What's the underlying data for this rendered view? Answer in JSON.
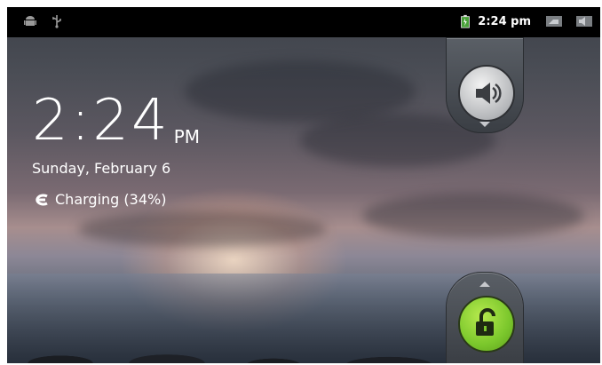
{
  "status_bar": {
    "left_icons": [
      "android-notification-icon",
      "usb-icon"
    ],
    "time": "2:24 pm",
    "right_icons": [
      "battery-charging-icon",
      "signal-icon",
      "volume-icon"
    ]
  },
  "lockscreen": {
    "time": "2:24",
    "ampm": "PM",
    "date": "Sunday, February 6",
    "charging_text": "Charging (34%)"
  },
  "controls": {
    "sound_toggle_icon": "speaker-sound-icon",
    "unlock_icon": "unlock-padlock-icon"
  },
  "colors": {
    "unlock_green": "#7bc72c",
    "status_bar_bg": "#000000"
  }
}
